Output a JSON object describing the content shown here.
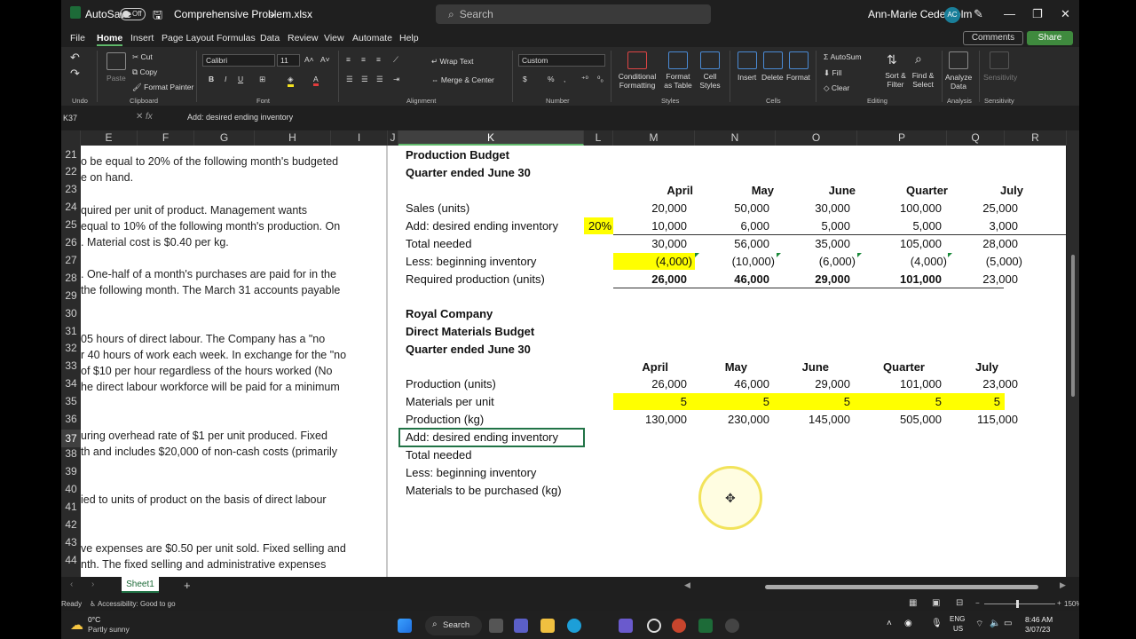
{
  "window": {
    "autosave_label": "AutoSave",
    "autosave_state": "Off",
    "filename": "Comprehensive Problem.xlsx",
    "search_placeholder": "Search",
    "user_name": "Ann-Marie Cederholm",
    "user_initials": "AC"
  },
  "menu": {
    "tabs": [
      "File",
      "Home",
      "Insert",
      "Page Layout",
      "Formulas",
      "Data",
      "Review",
      "View",
      "Automate",
      "Help"
    ],
    "active": "Home",
    "comments": "Comments",
    "share": "Share"
  },
  "ribbon": {
    "cut": "Cut",
    "copy": "Copy",
    "format_painter": "Format Painter",
    "paste": "Paste",
    "font_name": "Calibri",
    "font_size": "11",
    "wrap_text": "Wrap Text",
    "merge_center": "Merge & Center",
    "number_format": "Custom",
    "conditional_formatting": "Conditional Formatting",
    "format_as_table": "Format as Table",
    "cell_styles": "Cell Styles",
    "insert": "Insert",
    "delete": "Delete",
    "format": "Format",
    "autosum": "AutoSum",
    "fill": "Fill",
    "clear": "Clear",
    "sort_filter": "Sort & Filter",
    "find_select": "Find & Select",
    "analyze_data": "Analyze Data",
    "sensitivity": "Sensitivity",
    "groups": {
      "undo": "Undo",
      "clipboard": "Clipboard",
      "font": "Font",
      "alignment": "Alignment",
      "number": "Number",
      "styles": "Styles",
      "cells": "Cells",
      "editing": "Editing",
      "analysis": "Analysis",
      "sensitivity": "Sensitivity"
    }
  },
  "formula_bar": {
    "cell_ref": "K37",
    "fx": "fx",
    "content": "Add: desired ending inventory"
  },
  "columns": [
    "E",
    "F",
    "G",
    "H",
    "I",
    "J",
    "K",
    "L",
    "M",
    "N",
    "O",
    "P",
    "Q",
    "R"
  ],
  "rows": [
    "21",
    "22",
    "23",
    "24",
    "25",
    "26",
    "27",
    "28",
    "29",
    "30",
    "31",
    "32",
    "33",
    "34",
    "35",
    "36",
    "37",
    "38",
    "39",
    "40",
    "41",
    "42",
    "43",
    "44"
  ],
  "left_text": [
    "o be equal to 20% of the following month's budgeted",
    "e on hand.",
    "quired per unit of product.  Management wants",
    " equal to 10% of the following month's production.  On",
    ".  Material cost is $0.40 per kg.",
    ".  One-half of a month's purchases are paid for in the",
    "the following month.  The March 31 accounts payable",
    "05 hours of direct labour.  The Company has a \"no",
    "r 40 hours of work each week.  In exchange for the \"no",
    " of $10 per hour regardless of the hours worked (No",
    "he direct labour workforce will be paid for a minimum",
    "uring overhead rate of $1 per unit produced.  Fixed",
    "th and includes $20,000 of non-cash costs (primarily",
    "ied to units of product on the basis of direct labour",
    "ve expenses are $0.50 per unit sold.  Fixed selling and",
    "nth.  The fixed selling and administrative expenses"
  ],
  "production_budget": {
    "title": "Production Budget",
    "period": "Quarter ended June 30",
    "headers": [
      "April",
      "May",
      "June",
      "Quarter",
      "July"
    ],
    "percent": "20%",
    "rows": [
      {
        "label": "Sales (units)",
        "values": [
          "20,000",
          "50,000",
          "30,000",
          "100,000",
          "25,000"
        ]
      },
      {
        "label": "Add: desired ending inventory",
        "values": [
          "10,000",
          "6,000",
          "5,000",
          "5,000",
          "3,000"
        ]
      },
      {
        "label": "Total needed",
        "values": [
          "30,000",
          "56,000",
          "35,000",
          "105,000",
          "28,000"
        ]
      },
      {
        "label": "Less: beginning inventory",
        "values": [
          "(4,000)",
          "(10,000)",
          "(6,000)",
          "(4,000)",
          "(5,000)"
        ]
      },
      {
        "label": "Required production (units)",
        "values": [
          "26,000",
          "46,000",
          "29,000",
          "101,000",
          "23,000"
        ]
      }
    ]
  },
  "materials_budget": {
    "company": "Royal Company",
    "title": "Direct Materials Budget",
    "period": "Quarter ended June 30",
    "headers": [
      "April",
      "May",
      "June",
      "Quarter",
      "July"
    ],
    "rows": [
      {
        "label": "Production (units)",
        "values": [
          "26,000",
          "46,000",
          "29,000",
          "101,000",
          "23,000"
        ]
      },
      {
        "label": "Materials per unit",
        "values": [
          "5",
          "5",
          "5",
          "5",
          "5"
        ]
      },
      {
        "label": "Production (kg)",
        "values": [
          "130,000",
          "230,000",
          "145,000",
          "505,000",
          "115,000"
        ]
      },
      {
        "label": "Add: desired ending inventory",
        "values": [
          "",
          "",
          "",
          "",
          ""
        ]
      },
      {
        "label": "Total needed",
        "values": [
          "",
          "",
          "",
          "",
          ""
        ]
      },
      {
        "label": "Less: beginning inventory",
        "values": [
          "",
          "",
          "",
          "",
          ""
        ]
      },
      {
        "label": "Materials to be purchased (kg)",
        "values": [
          "",
          "",
          "",
          "",
          ""
        ]
      }
    ]
  },
  "sheet": {
    "tab": "Sheet1"
  },
  "status": {
    "ready": "Ready",
    "accessibility": "Accessibility: Good to go",
    "zoom": "150%"
  },
  "taskbar": {
    "temp": "0°C",
    "weather": "Partly sunny",
    "search": "Search",
    "lang1": "ENG",
    "lang2": "US",
    "time": "8:46 AM",
    "date": "3/07/23"
  },
  "colors": {
    "accent": "#217346",
    "highlight": "#ffff00",
    "dark_bg": "#1f1f1f"
  }
}
